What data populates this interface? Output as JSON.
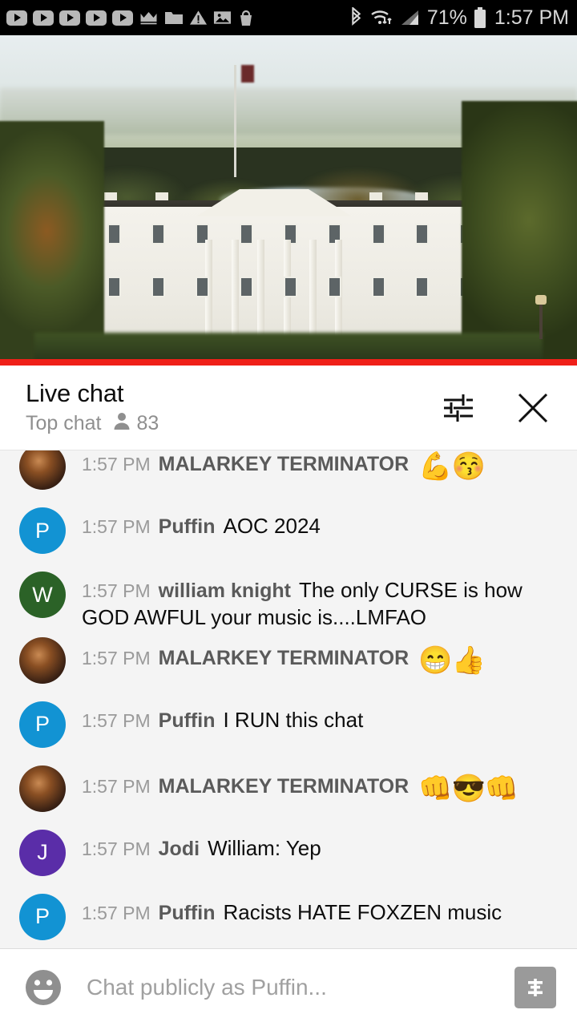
{
  "statusbar": {
    "notification_icons": [
      "youtube-icon",
      "youtube-icon",
      "youtube-icon",
      "youtube-icon",
      "youtube-icon",
      "crown-icon",
      "folder-icon",
      "warning-icon",
      "image-icon",
      "shopping-bag-icon"
    ],
    "bluetooth": "bluetooth-icon",
    "wifi": "wifi-transfer-icon",
    "signal": "cell-signal-icon",
    "battery_percent": "71%",
    "battery": "battery-icon",
    "time": "1:57 PM"
  },
  "video": {
    "description": "white-house-live-stream",
    "progress_percent": 100,
    "progress_color": "#ef2019"
  },
  "chat_header": {
    "title": "Live chat",
    "mode": "Top chat",
    "viewer_count": "83",
    "viewer_icon": "person-icon",
    "settings_icon": "tune-sliders-icon",
    "close_icon": "close-icon"
  },
  "messages": [
    {
      "time": "1:57 PM",
      "author": "MALARKEY TERMINATOR",
      "text": "",
      "emoji": "💪😚",
      "avatar_type": "photo",
      "avatar_letter": "",
      "avatar_color": "#6b3a1c",
      "clipped": true
    },
    {
      "time": "1:57 PM",
      "author": "Puffin",
      "text": "AOC 2024",
      "emoji": "",
      "avatar_type": "letter",
      "avatar_letter": "P",
      "avatar_color": "#1293d3"
    },
    {
      "time": "1:57 PM",
      "author": "william knight",
      "text": "The only CURSE is how GOD AWFUL your music is....LMFAO",
      "emoji": "",
      "avatar_type": "letter",
      "avatar_letter": "W",
      "avatar_color": "#2b6227"
    },
    {
      "time": "1:57 PM",
      "author": "MALARKEY TERMINATOR",
      "text": "",
      "emoji": "😁👍",
      "avatar_type": "photo",
      "avatar_letter": "",
      "avatar_color": "#6b3a1c"
    },
    {
      "time": "1:57 PM",
      "author": "Puffin",
      "text": "I RUN this chat",
      "emoji": "",
      "avatar_type": "letter",
      "avatar_letter": "P",
      "avatar_color": "#1293d3"
    },
    {
      "time": "1:57 PM",
      "author": "MALARKEY TERMINATOR",
      "text": "",
      "emoji": "👊😎👊",
      "avatar_type": "photo",
      "avatar_letter": "",
      "avatar_color": "#6b3a1c"
    },
    {
      "time": "1:57 PM",
      "author": "Jodi",
      "text": "William: Yep",
      "emoji": "",
      "avatar_type": "letter",
      "avatar_letter": "J",
      "avatar_color": "#5a2da8"
    },
    {
      "time": "1:57 PM",
      "author": "Puffin",
      "text": "Racists HATE FOXZEN music",
      "emoji": "",
      "avatar_type": "letter",
      "avatar_letter": "P",
      "avatar_color": "#1293d3"
    }
  ],
  "input_bar": {
    "emoji_icon": "emoji-face-icon",
    "placeholder": "Chat publicly as Puffin...",
    "value": "",
    "superchat_icon": "super-chat-dollar-icon"
  }
}
